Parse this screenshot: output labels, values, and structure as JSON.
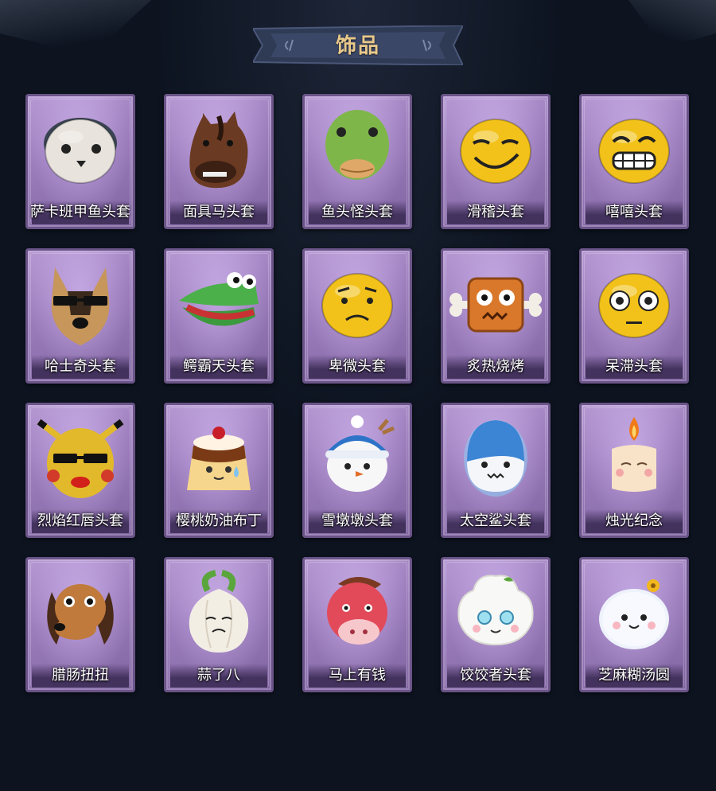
{
  "header": {
    "title": "饰品"
  },
  "items": [
    {
      "name": "萨卡班甲鱼头套",
      "icon": "fish-mask-icon"
    },
    {
      "name": "面具马头套",
      "icon": "horse-mask-icon"
    },
    {
      "name": "鱼头怪头套",
      "icon": "fish-monster-mask-icon"
    },
    {
      "name": "滑稽头套",
      "icon": "smirk-face-mask-icon"
    },
    {
      "name": "嘻嘻头套",
      "icon": "grin-face-mask-icon"
    },
    {
      "name": "哈士奇头套",
      "icon": "husky-mask-icon"
    },
    {
      "name": "鳄霸天头套",
      "icon": "crocodile-mask-icon"
    },
    {
      "name": "卑微头套",
      "icon": "humble-face-mask-icon"
    },
    {
      "name": "炙热烧烤",
      "icon": "bbq-meat-mask-icon"
    },
    {
      "name": "呆滞头套",
      "icon": "dazed-face-mask-icon"
    },
    {
      "name": "烈焰红唇头套",
      "icon": "red-lips-pikachu-mask-icon"
    },
    {
      "name": "樱桃奶油布丁",
      "icon": "pudding-mask-icon"
    },
    {
      "name": "雪墩墩头套",
      "icon": "snowman-mask-icon"
    },
    {
      "name": "太空鲨头套",
      "icon": "space-shark-mask-icon"
    },
    {
      "name": "烛光纪念",
      "icon": "candle-mask-icon"
    },
    {
      "name": "腊肠扭扭",
      "icon": "dachshund-mask-icon"
    },
    {
      "name": "蒜了八",
      "icon": "garlic-mask-icon"
    },
    {
      "name": "马上有钱",
      "icon": "red-horse-mask-icon"
    },
    {
      "name": "饺饺者头套",
      "icon": "dumpling-mask-icon"
    },
    {
      "name": "芝麻糊汤圆",
      "icon": "tangyuan-mask-icon"
    }
  ],
  "colors": {
    "background": "#0d1420",
    "card": "#9a7bbb",
    "title": "#e9c98a"
  }
}
